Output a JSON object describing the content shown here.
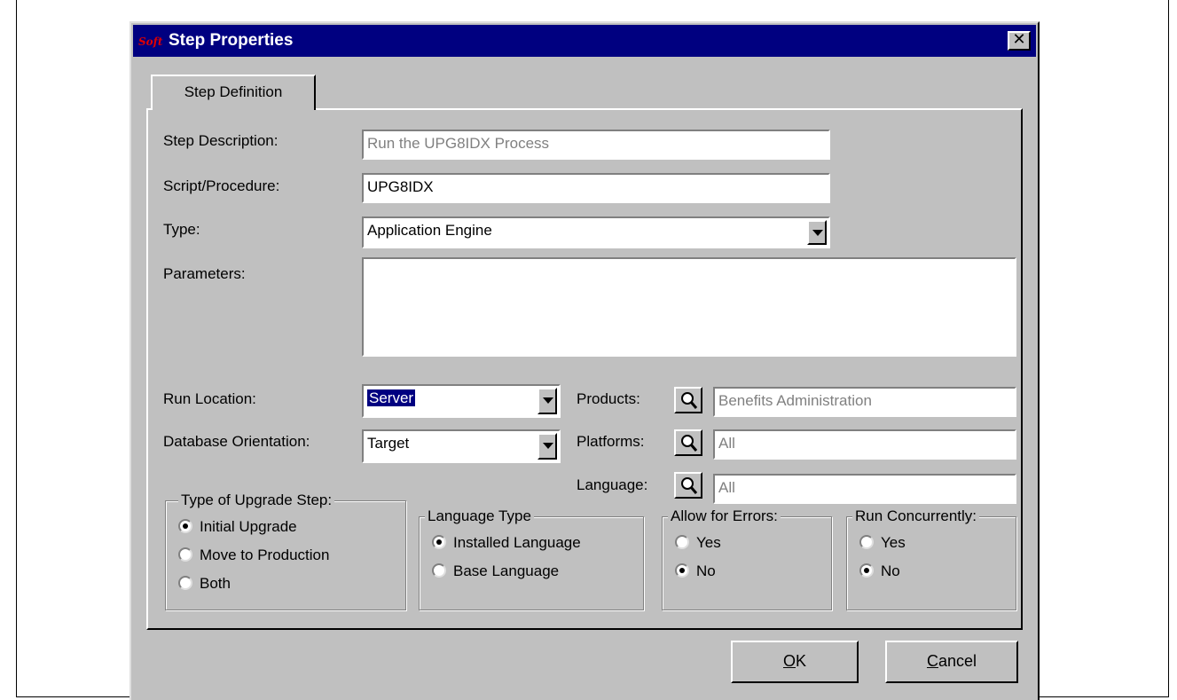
{
  "window": {
    "title": "Step Properties",
    "close_glyph": "✕",
    "app_icon": "soft-logo-icon",
    "app_icon_text": "Soft"
  },
  "tabs": [
    {
      "label": "Step Definition",
      "active": true
    }
  ],
  "form": {
    "step_description": {
      "label": "Step Description:",
      "value": "Run the UPG8IDX Process",
      "disabled": true
    },
    "script_procedure": {
      "label": "Script/Procedure:",
      "value": "UPG8IDX"
    },
    "type": {
      "label": "Type:",
      "value": "Application Engine"
    },
    "parameters": {
      "label": "Parameters:",
      "value": ""
    },
    "run_location": {
      "label": "Run Location:",
      "value": "Server"
    },
    "database_orientation": {
      "label": "Database Orientation:",
      "value": "Target"
    },
    "products": {
      "label": "Products:",
      "value": "Benefits Administration"
    },
    "platforms": {
      "label": "Platforms:",
      "value": "All"
    },
    "language": {
      "label": "Language:",
      "value": "All"
    }
  },
  "groups": {
    "upgrade_step": {
      "title": "Type of Upgrade Step:",
      "options": [
        {
          "label": "Initial Upgrade",
          "checked": true
        },
        {
          "label": "Move to Production",
          "checked": false
        },
        {
          "label": "Both",
          "checked": false
        }
      ]
    },
    "language_type": {
      "title": "Language Type",
      "options": [
        {
          "label": "Installed Language",
          "checked": true
        },
        {
          "label": "Base Language",
          "checked": false
        }
      ]
    },
    "allow_errors": {
      "title": "Allow for Errors:",
      "options": [
        {
          "label": "Yes",
          "checked": false
        },
        {
          "label": "No",
          "checked": true
        }
      ]
    },
    "run_concurrently": {
      "title": "Run Concurrently:",
      "options": [
        {
          "label": "Yes",
          "checked": false
        },
        {
          "label": "No",
          "checked": true
        }
      ]
    }
  },
  "buttons": {
    "ok": {
      "label_underlined": "O",
      "label_rest": "K"
    },
    "cancel": {
      "label_underlined": "C",
      "label_rest": "ancel"
    }
  },
  "colors": {
    "titlebar": "#000080",
    "face": "#c0c0c0",
    "selection": "#000080"
  }
}
